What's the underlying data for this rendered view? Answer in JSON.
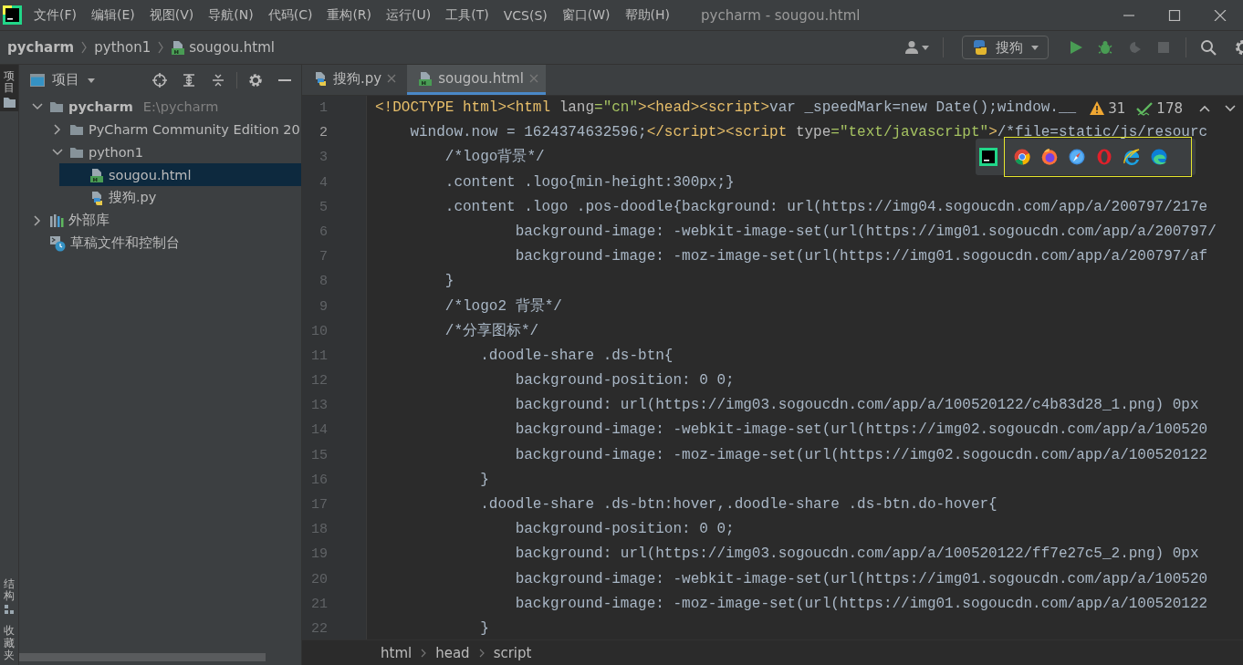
{
  "window": {
    "title": "pycharm - sougou.html"
  },
  "menu": [
    "文件(F)",
    "编辑(E)",
    "视图(V)",
    "导航(N)",
    "代码(C)",
    "重构(R)",
    "运行(U)",
    "工具(T)",
    "VCS(S)",
    "窗口(W)",
    "帮助(H)"
  ],
  "breadcrumbs": [
    {
      "label": "pycharm",
      "kind": "project"
    },
    {
      "label": "python1",
      "kind": "folder"
    },
    {
      "label": "sougou.html",
      "kind": "html"
    }
  ],
  "run_config": {
    "label": "搜狗"
  },
  "toolbar": [
    {
      "kind": "run",
      "disabled": false
    },
    {
      "kind": "debug",
      "disabled": false
    },
    {
      "kind": "coverage",
      "disabled": true
    },
    {
      "kind": "stop",
      "disabled": true
    }
  ],
  "side_stripe": [
    {
      "label": "项目",
      "selected": true
    },
    {
      "label": "结构",
      "selected": false
    },
    {
      "label": "收藏夹",
      "selected": false
    }
  ],
  "project": {
    "title": "项目",
    "tree": [
      {
        "label": "pycharm",
        "hint": "E:\\pycharm",
        "kind": "project",
        "expanded": true,
        "selected": false,
        "children": [
          {
            "label": "PyCharm Community Edition 20",
            "kind": "folder",
            "expanded": false,
            "selected": false
          },
          {
            "label": "python1",
            "kind": "folder",
            "expanded": true,
            "selected": false,
            "children": [
              {
                "label": "sougou.html",
                "kind": "html",
                "selected": true
              },
              {
                "label": "搜狗.py",
                "kind": "python",
                "selected": false
              }
            ]
          }
        ]
      },
      {
        "label": "外部库",
        "kind": "library",
        "expanded": false,
        "selected": false
      },
      {
        "label": "草稿文件和控制台",
        "kind": "scratch",
        "selected": false
      }
    ]
  },
  "tabs": [
    {
      "label": "搜狗.py",
      "kind": "python",
      "selected": false
    },
    {
      "label": "sougou.html",
      "kind": "html",
      "selected": true
    }
  ],
  "inspections": {
    "warnings": "31",
    "ok": "178"
  },
  "code": [
    {
      "number": "1",
      "current": false,
      "tokens": [
        {
          "t": "<!DOCTYPE html><html",
          "kind": "tag"
        },
        {
          "t": " lang",
          "kind": "attr"
        },
        {
          "t": "=\"cn\"",
          "kind": "str"
        },
        {
          "t": "><head><script>",
          "kind": "tag"
        },
        {
          "t": "var _speedMark=new Date();window.__",
          "kind": "text"
        }
      ]
    },
    {
      "number": "2",
      "current": true,
      "tokens": [
        {
          "t": "    window.now = 1624374632596;",
          "kind": "text"
        },
        {
          "t": "</script><script",
          "kind": "tag"
        },
        {
          "t": " type",
          "kind": "attr"
        },
        {
          "t": "=\"text/javascript\"",
          "kind": "str"
        },
        {
          "t": ">",
          "kind": "tag"
        },
        {
          "t": "/*file=static/js/resourc",
          "kind": "text"
        }
      ]
    },
    {
      "number": "3",
      "current": false,
      "text": "        /*logo背景*/"
    },
    {
      "number": "4",
      "current": false,
      "text": "        .content .logo{min-height:300px;}"
    },
    {
      "number": "5",
      "current": false,
      "text": "        .content .logo .pos-doodle{background: url(https://img04.sogoucdn.com/app/a/200797/217e"
    },
    {
      "number": "6",
      "current": false,
      "text": "                background-image: -webkit-image-set(url(https://img01.sogoucdn.com/app/a/200797/"
    },
    {
      "number": "7",
      "current": false,
      "text": "                background-image: -moz-image-set(url(https://img01.sogoucdn.com/app/a/200797/af"
    },
    {
      "number": "8",
      "current": false,
      "text": "        }"
    },
    {
      "number": "9",
      "current": false,
      "text": "        /*logo2 背景*/"
    },
    {
      "number": "10",
      "current": false,
      "text": "        /*分享图标*/"
    },
    {
      "number": "11",
      "current": false,
      "text": "            .doodle-share .ds-btn{"
    },
    {
      "number": "12",
      "current": false,
      "text": "                background-position: 0 0;"
    },
    {
      "number": "13",
      "current": false,
      "text": "                background: url(https://img03.sogoucdn.com/app/a/100520122/c4b83d28_1.png) 0px"
    },
    {
      "number": "14",
      "current": false,
      "text": "                background-image: -webkit-image-set(url(https://img02.sogoucdn.com/app/a/100520"
    },
    {
      "number": "15",
      "current": false,
      "text": "                background-image: -moz-image-set(url(https://img02.sogoucdn.com/app/a/100520122"
    },
    {
      "number": "16",
      "current": false,
      "text": "            }"
    },
    {
      "number": "17",
      "current": false,
      "text": "            .doodle-share .ds-btn:hover,.doodle-share .ds-btn.do-hover{"
    },
    {
      "number": "18",
      "current": false,
      "text": "                background-position: 0 0;"
    },
    {
      "number": "19",
      "current": false,
      "text": "                background: url(https://img03.sogoucdn.com/app/a/100520122/ff7e27c5_2.png) 0px"
    },
    {
      "number": "20",
      "current": false,
      "text": "                background-image: -webkit-image-set(url(https://img01.sogoucdn.com/app/a/100520"
    },
    {
      "number": "21",
      "current": false,
      "text": "                background-image: -moz-image-set(url(https://img01.sogoucdn.com/app/a/100520122"
    },
    {
      "number": "22",
      "current": false,
      "text": "            }"
    }
  ],
  "editor_breadcrumbs": [
    "html",
    "head",
    "script"
  ]
}
